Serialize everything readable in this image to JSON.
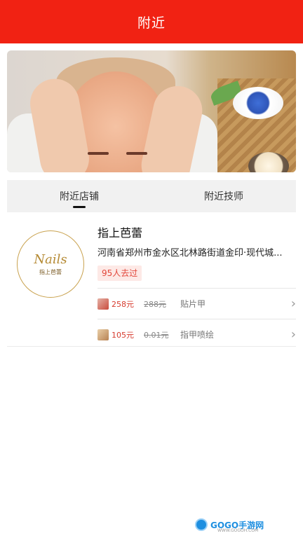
{
  "header": {
    "title": "附近"
  },
  "banner": {
    "dots": 1
  },
  "tabs": [
    {
      "label": "附近店铺",
      "active": true
    },
    {
      "label": "附近技师",
      "active": false
    }
  ],
  "shop": {
    "logo_text": "Nails",
    "logo_sub": "指上芭蕾",
    "name": "指上芭蕾",
    "address": "河南省郑州市金水区北林路街道金印·现代城...",
    "visits_badge": "95人去过",
    "offers": [
      {
        "price": "258元",
        "original": "288元",
        "title": "贴片甲",
        "thumb": "nail-thumb-red"
      },
      {
        "price": "105元",
        "original": "0.01元",
        "title": "指甲喷绘",
        "thumb": "nail-thumb-beige"
      }
    ]
  },
  "watermark": {
    "text": "GOGO手游网",
    "sub": "WWW.GOGOH.COM"
  },
  "colors": {
    "header_bg": "#f12213",
    "price": "#d63b2e",
    "badge_bg": "#fde9e6",
    "badge_text": "#e2463a"
  }
}
